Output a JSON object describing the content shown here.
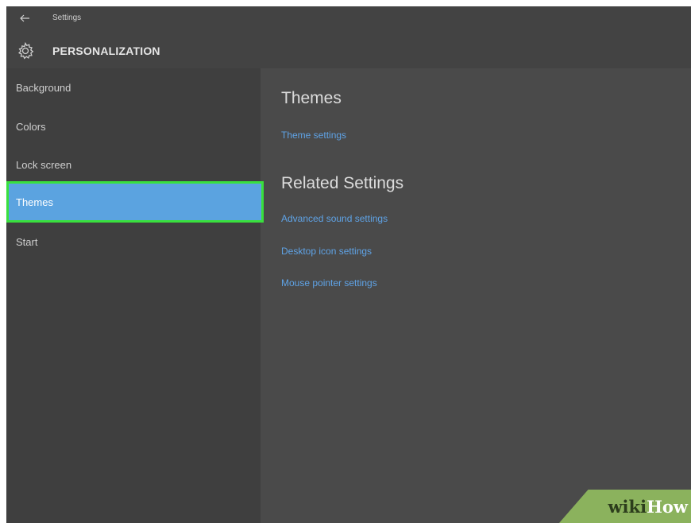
{
  "window": {
    "app_title": "Settings",
    "back_icon": "arrow-left-icon",
    "section_icon": "gear-icon",
    "section_title": "PERSONALIZATION"
  },
  "sidebar": {
    "items": [
      {
        "label": "Background"
      },
      {
        "label": "Colors"
      },
      {
        "label": "Lock screen"
      },
      {
        "label": "Themes",
        "selected": true
      },
      {
        "label": "Start"
      }
    ]
  },
  "main": {
    "themes_heading": "Themes",
    "theme_settings_link": "Theme settings",
    "related_heading": "Related Settings",
    "related_links": [
      "Advanced sound settings",
      "Desktop icon settings",
      "Mouse pointer settings"
    ]
  },
  "watermark": {
    "part1": "wiki",
    "part2": "How"
  },
  "colors": {
    "selected_bg": "#5ba3e0",
    "highlight_border": "#39e03d",
    "link": "#5fa3e6"
  }
}
